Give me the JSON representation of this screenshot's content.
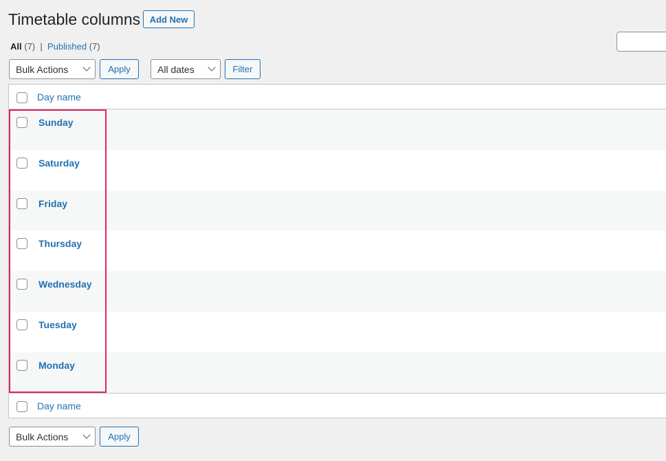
{
  "page_title": "Timetable columns",
  "add_new": "Add New",
  "views": {
    "all": "All",
    "all_count": "(7)",
    "sep": "|",
    "published": "Published",
    "published_count": "(7)"
  },
  "bulk_actions": "Bulk Actions",
  "apply": "Apply",
  "dates": "All dates",
  "filter": "Filter",
  "column_header": "Day name",
  "rows": [
    "Sunday",
    "Saturday",
    "Friday",
    "Thursday",
    "Wednesday",
    "Tuesday",
    "Monday"
  ],
  "highlight_color": "#e0245e",
  "accent": "#2271b1"
}
